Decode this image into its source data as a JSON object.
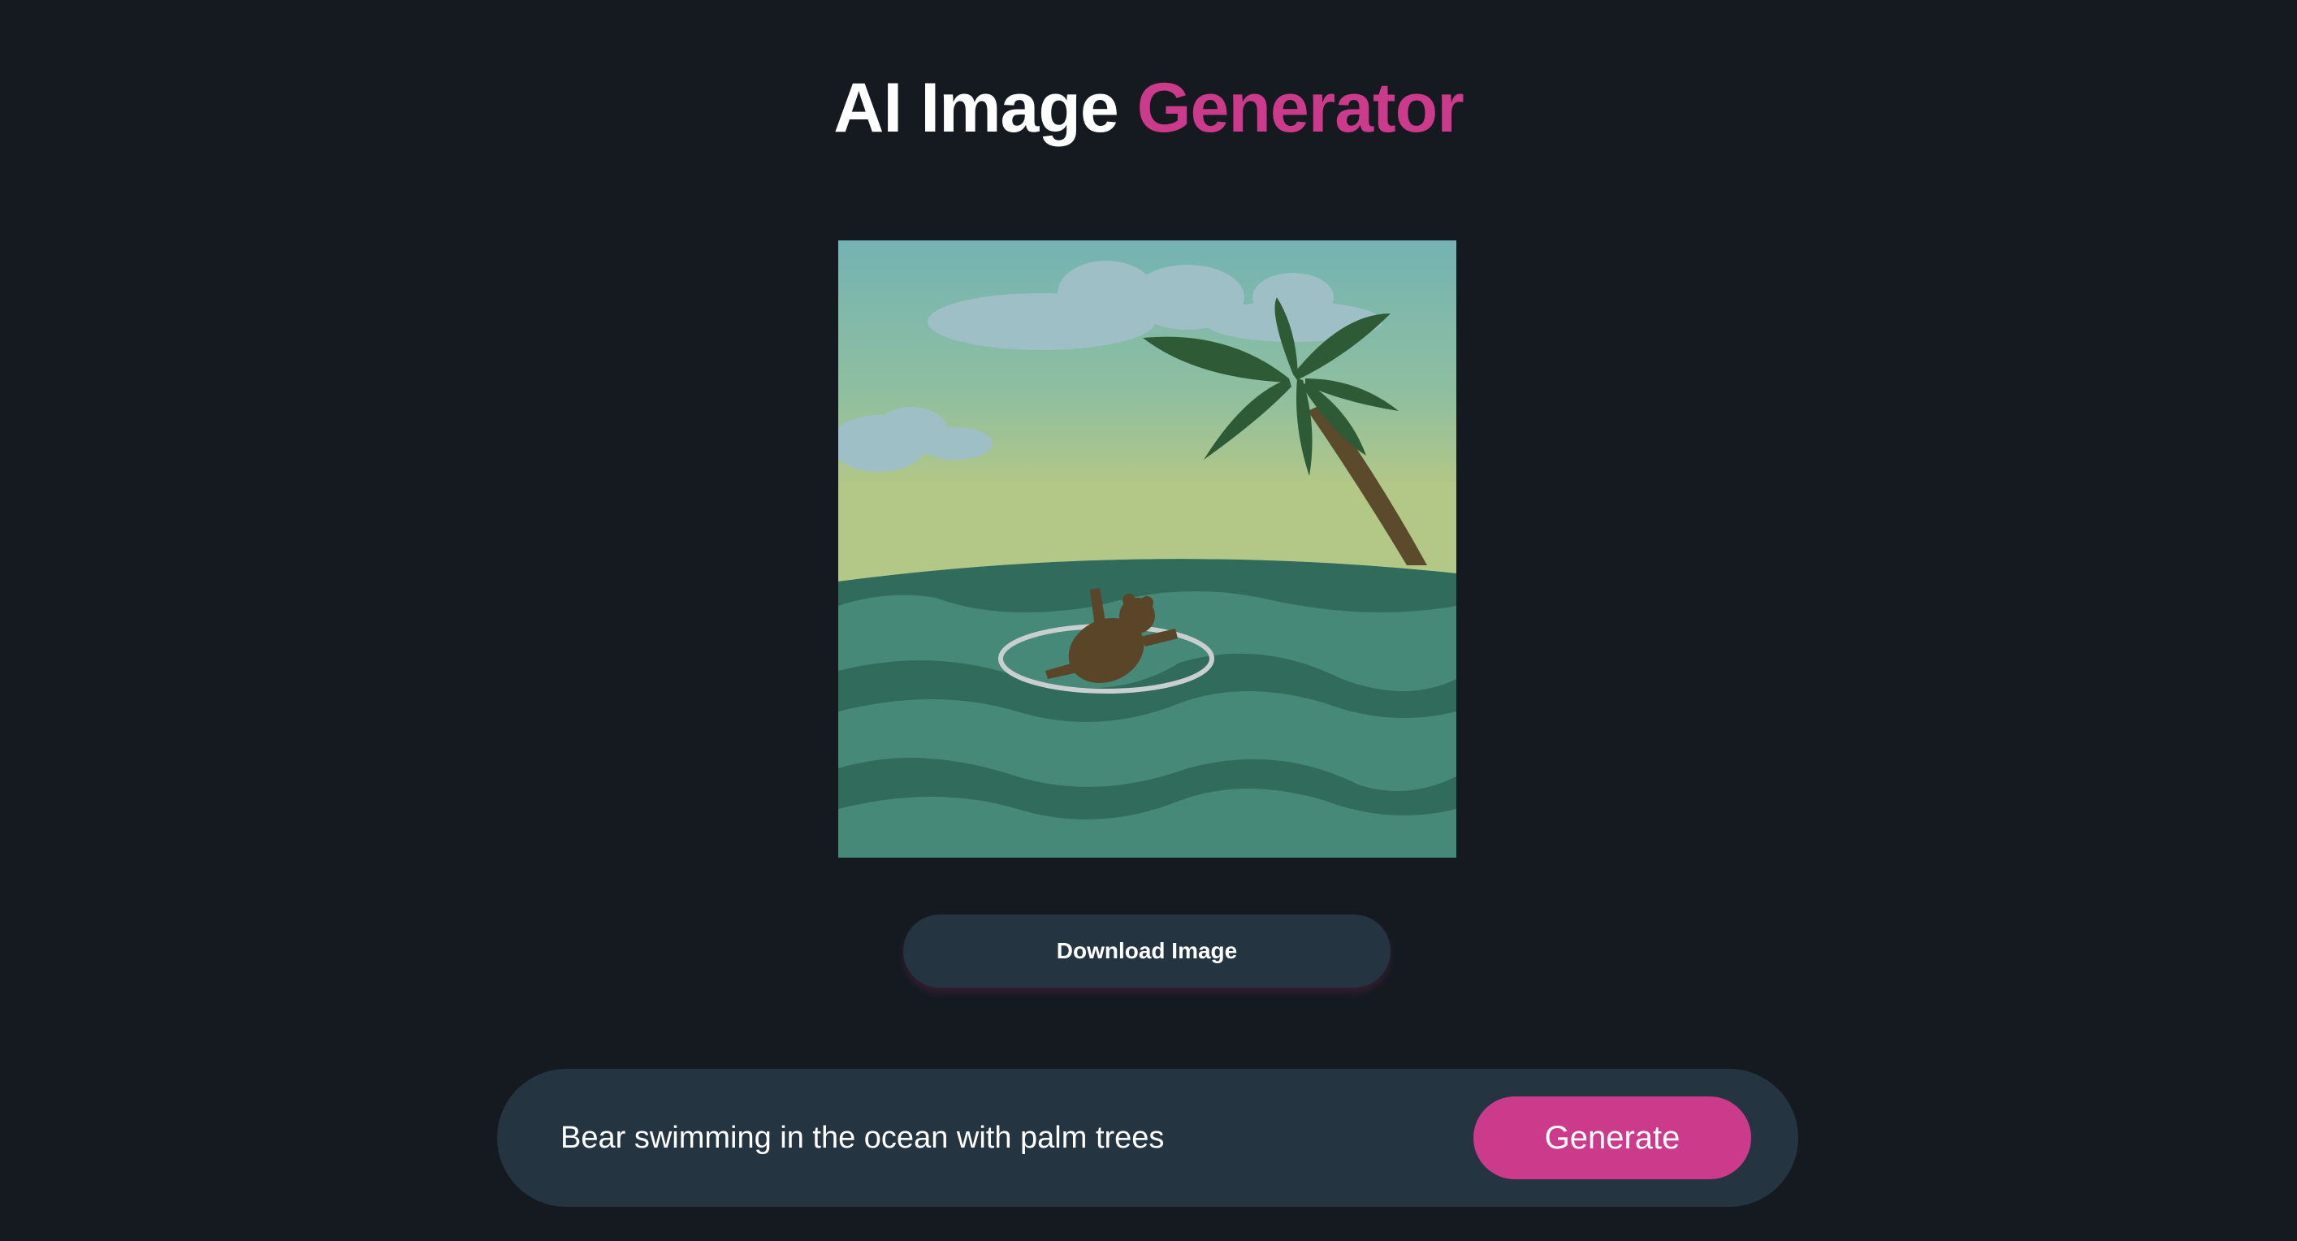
{
  "header": {
    "title_part1": "AI Image",
    "title_part2": "Generator"
  },
  "result": {
    "image_alt": "Bear swimming in the ocean with palm trees",
    "download_label": "Download Image"
  },
  "prompt": {
    "value": "Bear swimming in the ocean with palm trees",
    "generate_label": "Generate"
  },
  "colors": {
    "background": "#141a20",
    "surface": "#243440",
    "accent": "#cc3a8b",
    "text": "#ffffff"
  }
}
